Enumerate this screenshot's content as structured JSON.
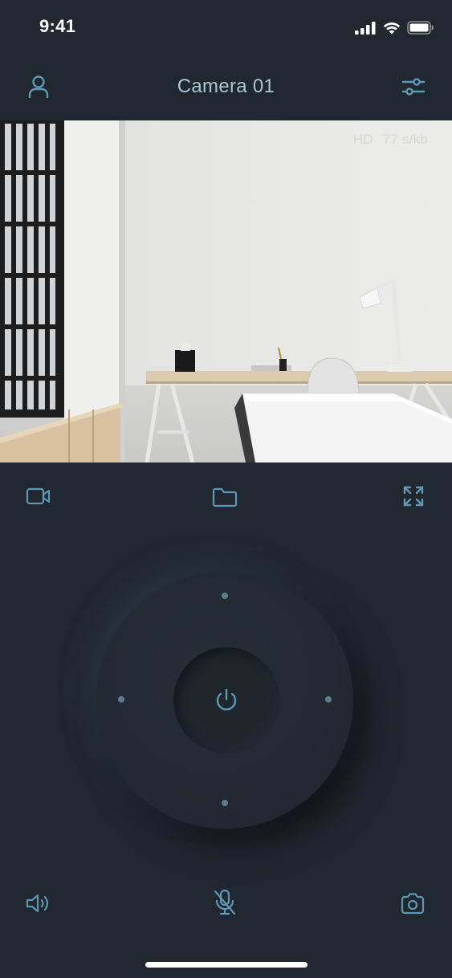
{
  "status_bar": {
    "time": "9:41"
  },
  "header": {
    "title": "Camera 01",
    "left_icon": "user-icon",
    "right_icon": "sliders-icon"
  },
  "video": {
    "quality": "HD",
    "bitrate": "77 s/kb"
  },
  "toolbar": {
    "icons": [
      "video-camera-icon",
      "folder-icon",
      "fullscreen-icon"
    ]
  },
  "bottom_bar": {
    "icons": [
      "speaker-icon",
      "microphone-muted-icon",
      "camera-icon"
    ]
  },
  "colors": {
    "background": "#21272e",
    "accent": "#5e97b5",
    "title": "#a9c6d3"
  }
}
